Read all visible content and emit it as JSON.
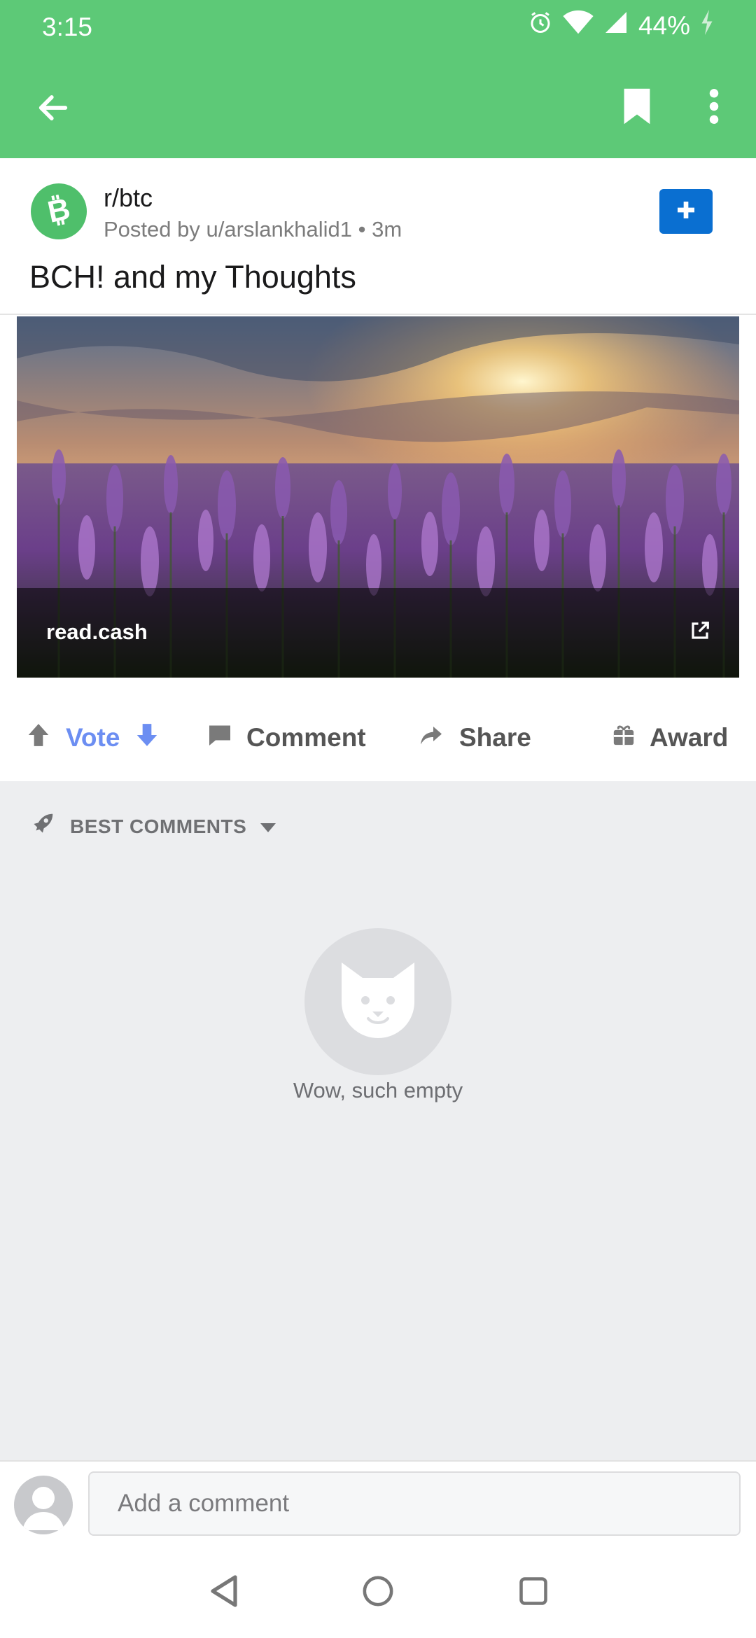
{
  "status_bar": {
    "time": "3:15",
    "battery": "44%"
  },
  "toolbar": {
    "back_icon": "arrow-left-icon",
    "bookmark_icon": "bookmark-icon",
    "more_icon": "more-vertical-icon"
  },
  "post": {
    "subreddit": "r/btc",
    "meta": "Posted by u/arslankhalid1 • 3m",
    "title": "BCH! and my Thoughts",
    "link_domain": "read.cash"
  },
  "actions": {
    "vote": "Vote",
    "comment": "Comment",
    "share": "Share",
    "award": "Award"
  },
  "comments": {
    "sort_label": "BEST COMMENTS",
    "empty_text": "Wow, such empty"
  },
  "composer": {
    "placeholder": "Add a comment"
  },
  "colors": {
    "header": "#5dc977",
    "join_button": "#0a6fd1",
    "vote_accent": "#6c8ef2",
    "comments_bg": "#edeef0"
  }
}
